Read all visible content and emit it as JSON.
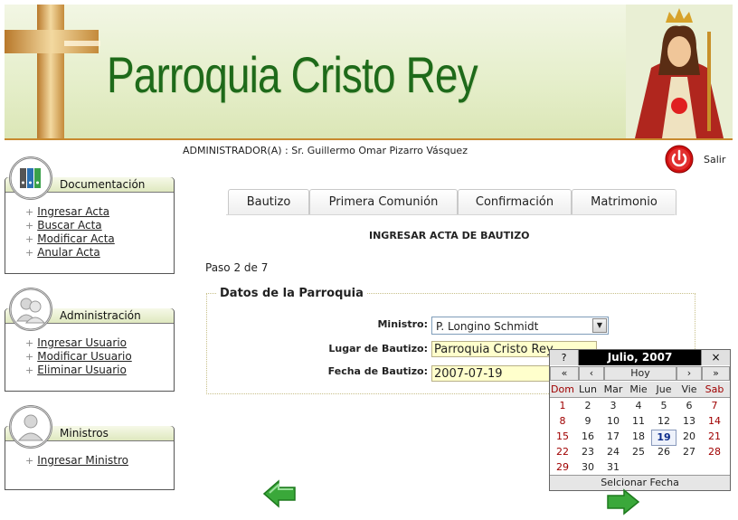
{
  "header": {
    "title": "Parroquia Cristo Rey"
  },
  "user": {
    "admin_line": "ADMINISTRADOR(A) : Sr. Guillermo Omar Pizarro Vásquez",
    "exit_label": "Salir"
  },
  "sidebar": {
    "documentacion": {
      "title": "Documentación",
      "items": [
        "Ingresar Acta",
        "Buscar Acta",
        "Modificar Acta",
        "Anular Acta"
      ]
    },
    "administracion": {
      "title": "Administración",
      "items": [
        "Ingresar Usuario",
        "Modificar Usuario",
        "Eliminar Usuario"
      ]
    },
    "ministros": {
      "title": "Ministros",
      "items": [
        "Ingresar Ministro"
      ]
    }
  },
  "tabs": [
    "Bautizo",
    "Primera Comunión",
    "Confirmación",
    "Matrimonio"
  ],
  "form": {
    "title": "INGRESAR ACTA DE BAUTIZO",
    "step": "Paso 2 de 7",
    "legend": "Datos de la Parroquia",
    "ministro_label": "Ministro:",
    "ministro_value": "P. Longino Schmidt",
    "lugar_label": "Lugar de Bautizo:",
    "lugar_value": "Parroquia Cristo Rey",
    "fecha_label": "Fecha de Bautizo:",
    "fecha_value": "2007-07-19"
  },
  "calendar": {
    "help": "?",
    "month": "Julio, 2007",
    "close": "×",
    "prev_year": "«",
    "prev_month": "‹",
    "today": "Hoy",
    "next_month": "›",
    "next_year": "»",
    "weekdays": [
      "Dom",
      "Lun",
      "Mar",
      "Mie",
      "Jue",
      "Vie",
      "Sab"
    ],
    "weeks": [
      [
        "1",
        "2",
        "3",
        "4",
        "5",
        "6",
        "7"
      ],
      [
        "8",
        "9",
        "10",
        "11",
        "12",
        "13",
        "14"
      ],
      [
        "15",
        "16",
        "17",
        "18",
        "19",
        "20",
        "21"
      ],
      [
        "22",
        "23",
        "24",
        "25",
        "26",
        "27",
        "28"
      ],
      [
        "29",
        "30",
        "31",
        "",
        "",
        "",
        ""
      ]
    ],
    "selected": "19",
    "footer": "Selcionar Fecha"
  },
  "colors": {
    "title_green": "#1e6a1a",
    "weekend_red": "#a00000",
    "field_yellow": "#ffffcc",
    "exit_red": "#d01010"
  }
}
